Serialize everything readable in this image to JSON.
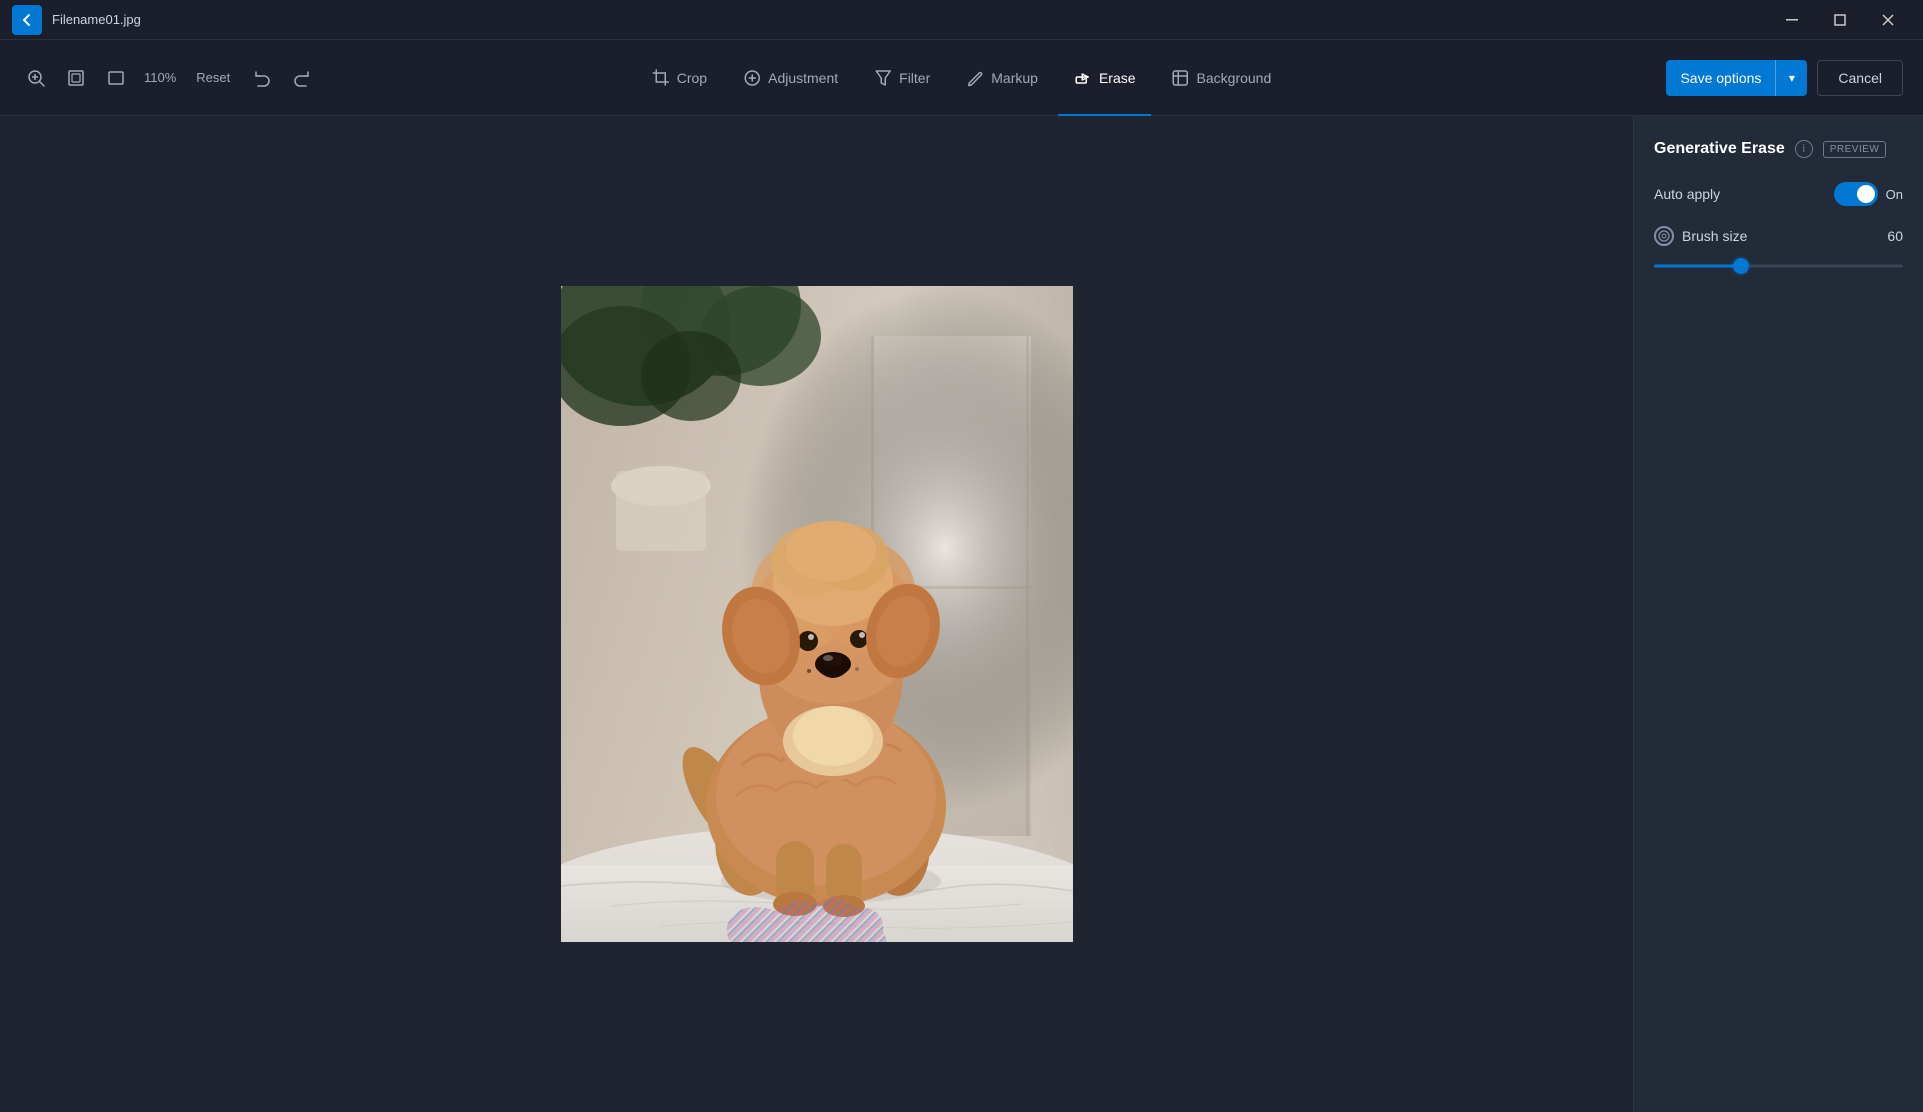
{
  "titlebar": {
    "filename": "Filename01.jpg",
    "back_label": "back"
  },
  "toolbar": {
    "zoom_level": "110%",
    "reset_label": "Reset",
    "tabs": [
      {
        "id": "crop",
        "label": "Crop",
        "icon": "crop"
      },
      {
        "id": "adjustment",
        "label": "Adjustment",
        "icon": "adjustment"
      },
      {
        "id": "filter",
        "label": "Filter",
        "icon": "filter"
      },
      {
        "id": "markup",
        "label": "Markup",
        "icon": "markup"
      },
      {
        "id": "erase",
        "label": "Erase",
        "icon": "erase"
      },
      {
        "id": "background",
        "label": "Background",
        "icon": "background"
      }
    ],
    "active_tab": "erase",
    "save_options_label": "Save options",
    "cancel_label": "Cancel"
  },
  "right_panel": {
    "title": "Generative Erase",
    "preview_badge": "PREVIEW",
    "auto_apply_label": "Auto apply",
    "auto_apply_state": "On",
    "brush_size_label": "Brush size",
    "brush_size_value": "60",
    "slider_percent": 35
  },
  "icons": {
    "back": "←",
    "zoom_in": "🔍",
    "fit": "⊞",
    "aspect": "▣",
    "undo": "↩",
    "redo": "↪",
    "dropdown": "▾",
    "crop_icon": "⊡",
    "adjustment_icon": "☀",
    "filter_icon": "⊘",
    "markup_icon": "✎",
    "erase_icon": "◈",
    "background_icon": "▦",
    "info": "i",
    "brush": "◎"
  }
}
